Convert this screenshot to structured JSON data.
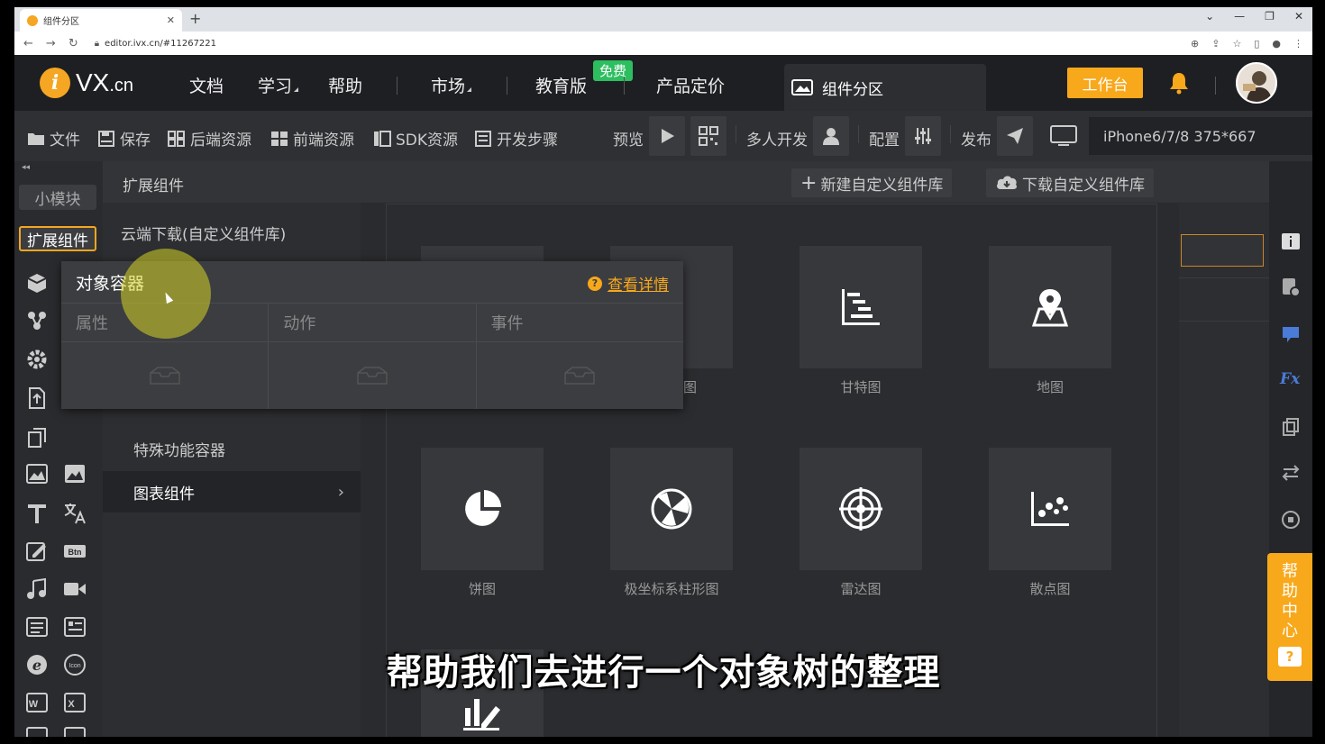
{
  "browser": {
    "tab_title": "组件分区",
    "url": "editor.ivx.cn/#11267221"
  },
  "topnav": {
    "logo_text": "VX",
    "logo_suffix": ".cn",
    "links": [
      "文档",
      "学习",
      "帮助",
      "市场",
      "教育版",
      "产品定价"
    ],
    "free_badge": "免费",
    "active_tab": "组件分区",
    "workbench_button": "工作台"
  },
  "toolbar": {
    "file": "文件",
    "save": "保存",
    "backend": "后端资源",
    "frontend": "前端资源",
    "sdk": "SDK资源",
    "steps": "开发步骤",
    "preview": "预览",
    "multi_dev": "多人开发",
    "config": "配置",
    "publish": "发布",
    "device": "iPhone6/7/8 375*667"
  },
  "rail": {
    "mini_module": "小模块",
    "ext_components": "扩展组件"
  },
  "panel": {
    "header": "扩展组件",
    "new_library": "新建自定义组件库",
    "download_library": "下载自定义组件库",
    "cloud_download": "云端下载(自定义组件库)",
    "special_container": "特殊功能容器",
    "chart_components": "图表组件"
  },
  "popup": {
    "title": "对象容器",
    "detail_link": "查看详情",
    "tabs": [
      "属性",
      "动作",
      "事件"
    ]
  },
  "grid": {
    "row1": [
      "图",
      "甘特图",
      "地图"
    ],
    "row2": [
      "饼图",
      "极坐标系柱形图",
      "雷达图",
      "散点图"
    ]
  },
  "help_center": [
    "帮",
    "助",
    "中",
    "心"
  ],
  "subtitle": "帮助我们去进行一个对象树的整理",
  "colors": {
    "accent": "#f8a81b",
    "free_badge": "#2dbe60",
    "background": "#2a2b2e"
  }
}
